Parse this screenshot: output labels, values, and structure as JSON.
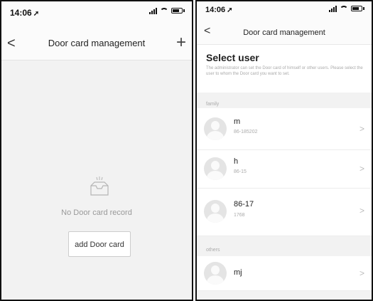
{
  "left": {
    "time": "14:06",
    "title": "Door card management",
    "back_glyph": "<",
    "add_glyph": "+",
    "empty_text": "No Door card record",
    "button_label": "add Door card"
  },
  "right": {
    "time": "14:06",
    "title": "Door card management",
    "back_glyph": "<",
    "heading": "Select user",
    "description": "The administrator can set the Door card of himself or other users. Please select the user to whom the Door card you want to set.",
    "family_label": "family",
    "others_label": "others",
    "chevron": ">",
    "users": [
      {
        "name": "m",
        "sub": "86-185202"
      },
      {
        "name": "h",
        "sub": "86-15"
      },
      {
        "name": "86-17",
        "sub": "1768"
      },
      {
        "name": "mj",
        "sub": ""
      }
    ]
  },
  "icons": [
    "navigation-arrow-icon",
    "signal-icon",
    "wifi-icon",
    "battery-icon",
    "back-chevron-icon",
    "add-icon",
    "empty-box-icon",
    "avatar-icon",
    "chevron-right-icon"
  ]
}
